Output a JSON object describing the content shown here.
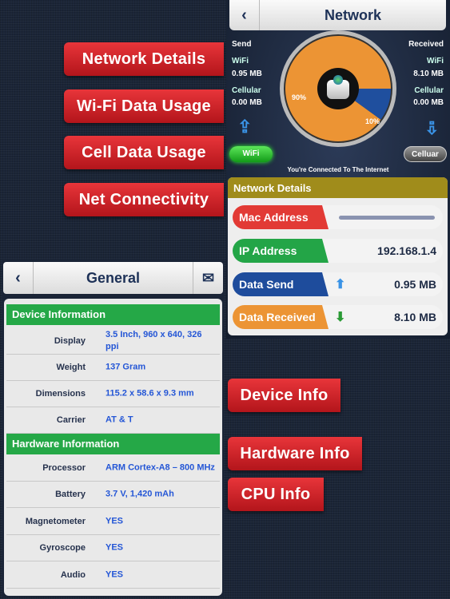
{
  "feature_tags": [
    "Network Details",
    "Wi-Fi Data Usage",
    "Cell Data Usage",
    "Net Connectivity",
    "Device Info",
    "Hardware Info",
    "CPU Info"
  ],
  "network": {
    "title": "Network",
    "send_label": "Send",
    "received_label": "Received",
    "send": {
      "wifi_label": "WiFi",
      "wifi": "0.95 MB",
      "cell_label": "Cellular",
      "cell": "0.00 MB"
    },
    "received": {
      "wifi_label": "WiFi",
      "wifi": "8.10 MB",
      "cell_label": "Cellular",
      "cell": "0.00 MB"
    },
    "pie": {
      "wifi_pct": "90%",
      "cell_pct": "10%",
      "wifi_value": 90,
      "cell_value": 10,
      "colors": {
        "wifi": "#ec9434",
        "cell": "#1f4f9e"
      }
    },
    "wifi_button": "WiFi",
    "cellular_button": "Celluar",
    "status": "You're Connected To The Internet",
    "details": {
      "title": "Network Details",
      "rows": [
        {
          "label": "Mac Address",
          "value": "",
          "color": "#e23a35"
        },
        {
          "label": "IP Address",
          "value": "192.168.1.4",
          "color": "#23a547"
        },
        {
          "label": "Data Send",
          "value": "0.95 MB",
          "color": "#1e4c9c"
        },
        {
          "label": "Data Received",
          "value": "8.10 MB",
          "color": "#ec9434"
        }
      ]
    }
  },
  "general": {
    "title": "General",
    "device_section": "Device Information",
    "device_rows": [
      {
        "k": "Display",
        "v": "3.5 Inch, 960 x 640, 326 ppi"
      },
      {
        "k": "Weight",
        "v": "137 Gram"
      },
      {
        "k": "Dimensions",
        "v": "115.2 x 58.6 x 9.3 mm"
      },
      {
        "k": "Carrier",
        "v": "AT & T"
      }
    ],
    "hardware_section": "Hardware Information",
    "hardware_rows": [
      {
        "k": "Processor",
        "v": "ARM Cortex-A8 – 800 MHz"
      },
      {
        "k": "Battery",
        "v": "3.7 V, 1,420 mAh"
      },
      {
        "k": "Magnetometer",
        "v": "YES"
      },
      {
        "k": "Gyroscope",
        "v": "YES"
      },
      {
        "k": "Audio",
        "v": "YES"
      }
    ]
  }
}
